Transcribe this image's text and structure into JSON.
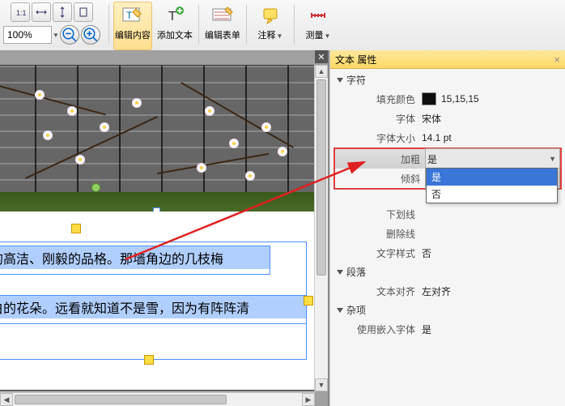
{
  "toolbar": {
    "zoom": "100%",
    "edit_content": "编辑内容",
    "add_text": "添加文本",
    "edit_form": "编辑表单",
    "annotate": "注释",
    "measure": "测量"
  },
  "props_panel": {
    "title": "文本 属性",
    "sections": {
      "chars": "字符",
      "para": "段落",
      "misc": "杂项"
    },
    "rows": {
      "fill_color": {
        "label": "填充颜色",
        "value": "15,15,15"
      },
      "font": {
        "label": "字体",
        "value": "宋体"
      },
      "font_size": {
        "label": "字体大小",
        "value": "14.1 pt"
      },
      "bold": {
        "label": "加粗",
        "value": "是"
      },
      "italic": {
        "label": "倾斜",
        "value": ""
      },
      "underline": {
        "label": "下划线",
        "value": ""
      },
      "strikethrough": {
        "label": "删除线",
        "value": ""
      },
      "text_style": {
        "label": "文字样式",
        "value": "否"
      },
      "alignment": {
        "label": "文本对齐",
        "value": "左对齐"
      },
      "embed_font": {
        "label": "使用嵌入字体",
        "value": "是"
      }
    },
    "dropdown": {
      "opt_yes": "是",
      "opt_no": "否"
    }
  },
  "doc_text": {
    "line1": "的高洁、刚毅的品格。那墙角边的几枝梅",
    "line2": "白的花朵。远看就知道不是雪，因为有阵阵清"
  }
}
